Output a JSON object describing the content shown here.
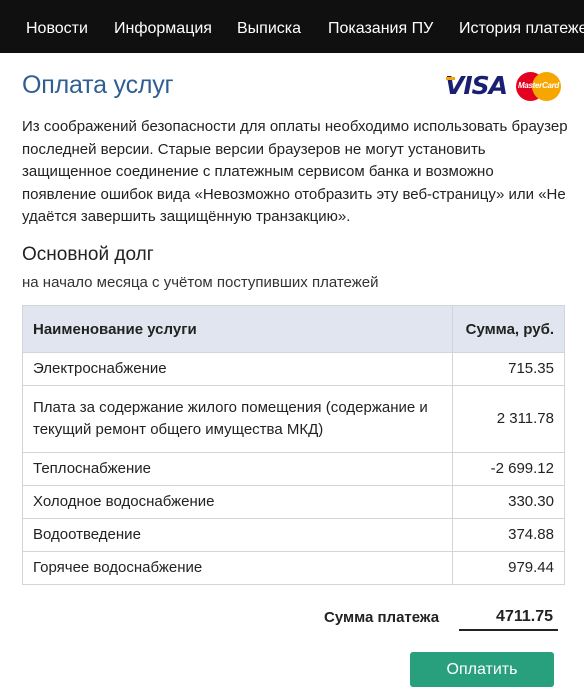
{
  "nav": {
    "items": [
      {
        "label": "Новости"
      },
      {
        "label": "Информация"
      },
      {
        "label": "Выписка"
      },
      {
        "label": "Показания ПУ"
      },
      {
        "label": "История платежей"
      }
    ]
  },
  "page": {
    "title": "Оплата услуг",
    "notice": "Из соображений безопасности для оплаты необходимо использовать браузер последней версии. Старые версии браузеров не могут установить защищенное соединение с платежным сервисом банка и возможно появление ошибок вида «Невозможно отобразить эту веб-страницу» или «Не удаётся завершить защищённую транзакцию»."
  },
  "payment_logos": {
    "visa": "VISA",
    "mastercard": "MasterCard"
  },
  "debt": {
    "title": "Основной долг",
    "subtitle": "на начало месяца с учётом поступивших платежей",
    "columns": {
      "name": "Наименование услуги",
      "sum": "Сумма, руб."
    },
    "rows": [
      {
        "name": "Электроснабжение",
        "sum": "715.35"
      },
      {
        "name": "Плата за содержание жилого помещения (содержание и текущий ремонт общего имущества МКД)",
        "sum": "2 311.78"
      },
      {
        "name": "Теплоснабжение",
        "sum": "-2 699.12"
      },
      {
        "name": "Холодное водоснабжение",
        "sum": "330.30"
      },
      {
        "name": "Водоотведение",
        "sum": "374.88"
      },
      {
        "name": "Горячее водоснабжение",
        "sum": "979.44"
      }
    ]
  },
  "total": {
    "label": "Сумма платежа",
    "value": "4711.75"
  },
  "actions": {
    "pay_label": "Оплатить"
  },
  "colors": {
    "title": "#2f5e93",
    "nav_bg": "#101010",
    "header_bg": "#e1e5f0",
    "pay_button": "#28a07e"
  }
}
